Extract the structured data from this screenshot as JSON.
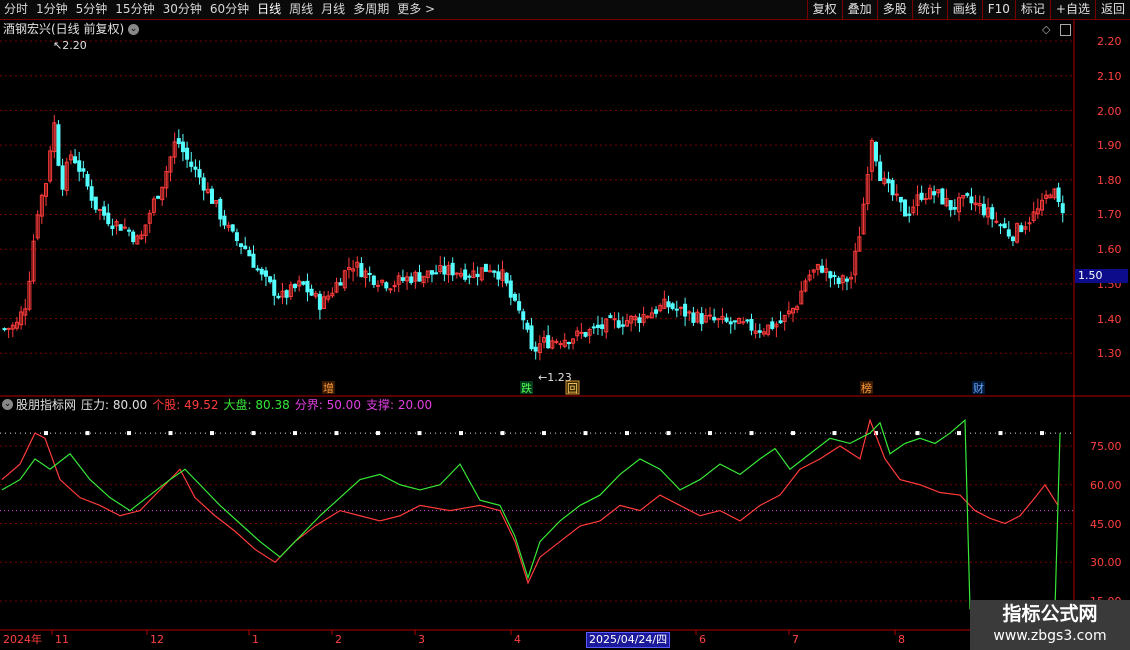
{
  "toolbar": {
    "periods": [
      "分时",
      "1分钟",
      "5分钟",
      "15分钟",
      "30分钟",
      "60分钟",
      "日线",
      "周线",
      "月线",
      "多周期",
      "更多 >"
    ],
    "active_period": "日线",
    "actions": [
      "复权",
      "叠加",
      "多股",
      "统计",
      "画线",
      "F10",
      "标记",
      "+自选",
      "返回"
    ]
  },
  "main_chart": {
    "title": "酒钢宏兴(日线 前复权)",
    "high_label": "2.20",
    "low_label": "1.23",
    "price_axis": [
      "2.20",
      "2.10",
      "2.00",
      "1.90",
      "1.80",
      "1.70",
      "1.60",
      "1.50",
      "1.40",
      "1.30"
    ],
    "current_price": "1.50",
    "event_markers": [
      "增",
      "跌",
      "回",
      "榜",
      "财"
    ],
    "icons": [
      "chevron-down-icon",
      "diamond-icon",
      "panel-icon"
    ]
  },
  "indicator": {
    "name": "股朋指标网",
    "params": [
      {
        "label": "压力",
        "value": "80.00",
        "color": "#e0e0e0"
      },
      {
        "label": "个股",
        "value": "49.52",
        "color": "#ff3b3b"
      },
      {
        "label": "大盘",
        "value": "80.38",
        "color": "#37e837"
      },
      {
        "label": "分界",
        "value": "50.00",
        "color": "#e040e0"
      },
      {
        "label": "支撑",
        "value": "20.00",
        "color": "#e040e0"
      }
    ],
    "axis": [
      "75.00",
      "60.00",
      "45.00",
      "30.00",
      "15.00"
    ]
  },
  "time_axis": {
    "labels": [
      "2024年",
      "11",
      "12",
      "1",
      "2",
      "3",
      "4",
      "2025/04/24/四",
      "6",
      "7",
      "8"
    ]
  },
  "watermark": {
    "title": "指标公式网",
    "url": "www.zbgs3.com"
  },
  "colors": {
    "up": "#ff3b3b",
    "down": "#54ffff",
    "grid": "#8a0000",
    "volume_line": "#37e837"
  }
}
